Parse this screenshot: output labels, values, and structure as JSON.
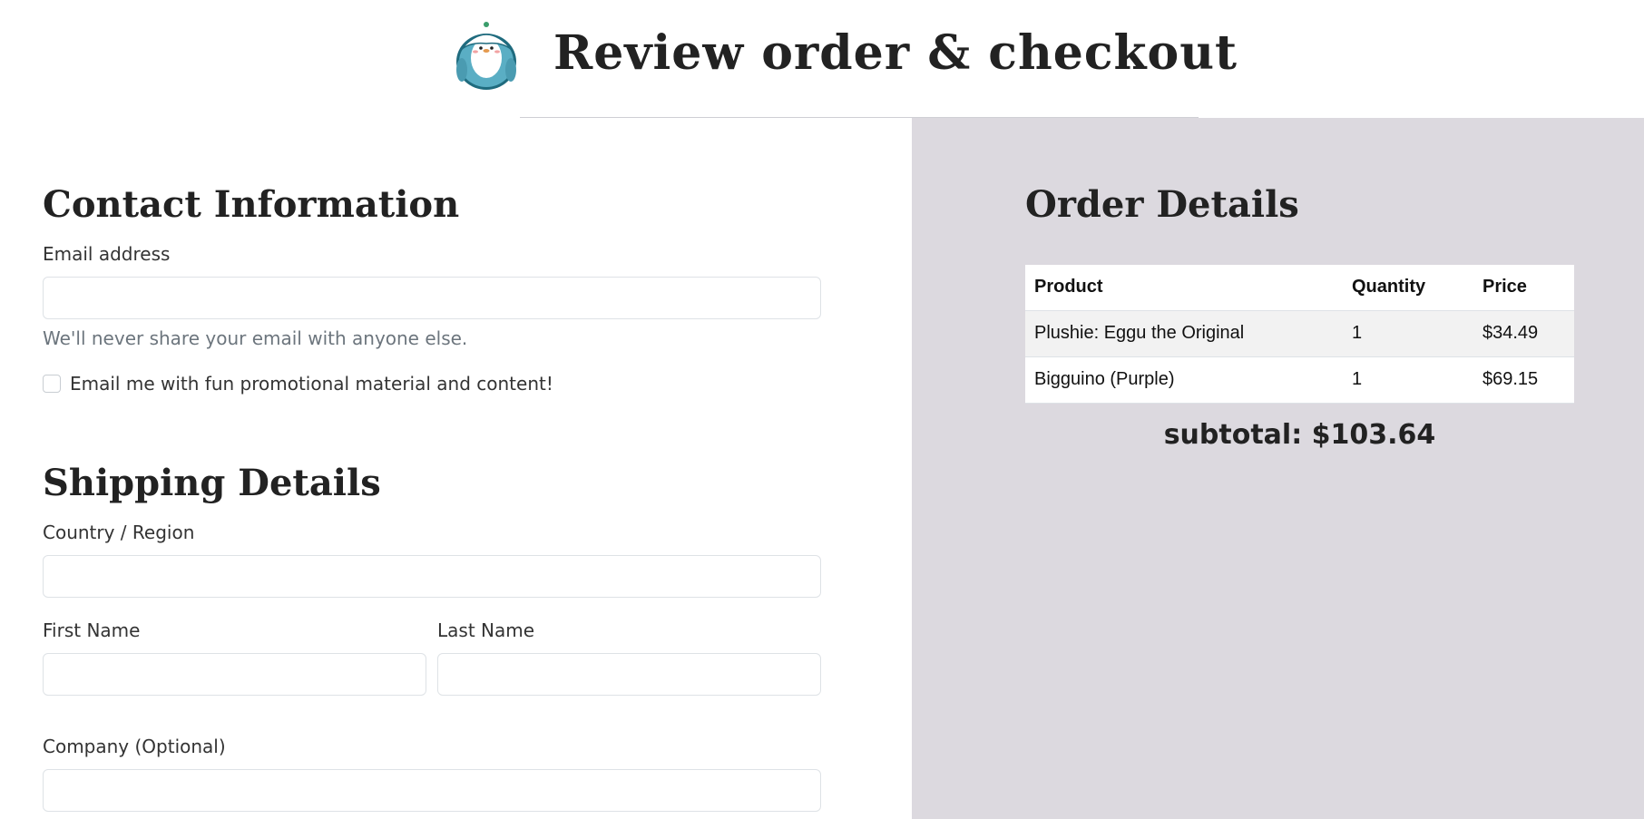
{
  "header": {
    "title": "Review order & checkout",
    "logo_icon": "penguin-mascot-icon"
  },
  "contact": {
    "title": "Contact Information",
    "email_label": "Email address",
    "email_value": "",
    "email_placeholder": "",
    "email_help": "We'll never share your email with anyone else.",
    "promo_checkbox_label": "Email me with fun promotional material and content!",
    "promo_checked": false
  },
  "shipping": {
    "title": "Shipping Details",
    "country_label": "Country / Region",
    "country_value": "",
    "first_name_label": "First Name",
    "first_name_value": "",
    "last_name_label": "Last Name",
    "last_name_value": "",
    "company_label": "Company (Optional)",
    "company_value": ""
  },
  "order": {
    "title": "Order Details",
    "columns": [
      "Product",
      "Quantity",
      "Price"
    ],
    "rows": [
      {
        "product": "Plushie: Eggu the Original",
        "quantity": "1",
        "price": "$34.49"
      },
      {
        "product": "Bigguino (Purple)",
        "quantity": "1",
        "price": "$69.15"
      }
    ],
    "subtotal_label": "subtotal:",
    "subtotal_value": "$103.64"
  },
  "colors": {
    "summary_panel_bg": "#dcd9df",
    "logo_teal": "#5aaec4",
    "logo_dark": "#1f6b7e"
  }
}
